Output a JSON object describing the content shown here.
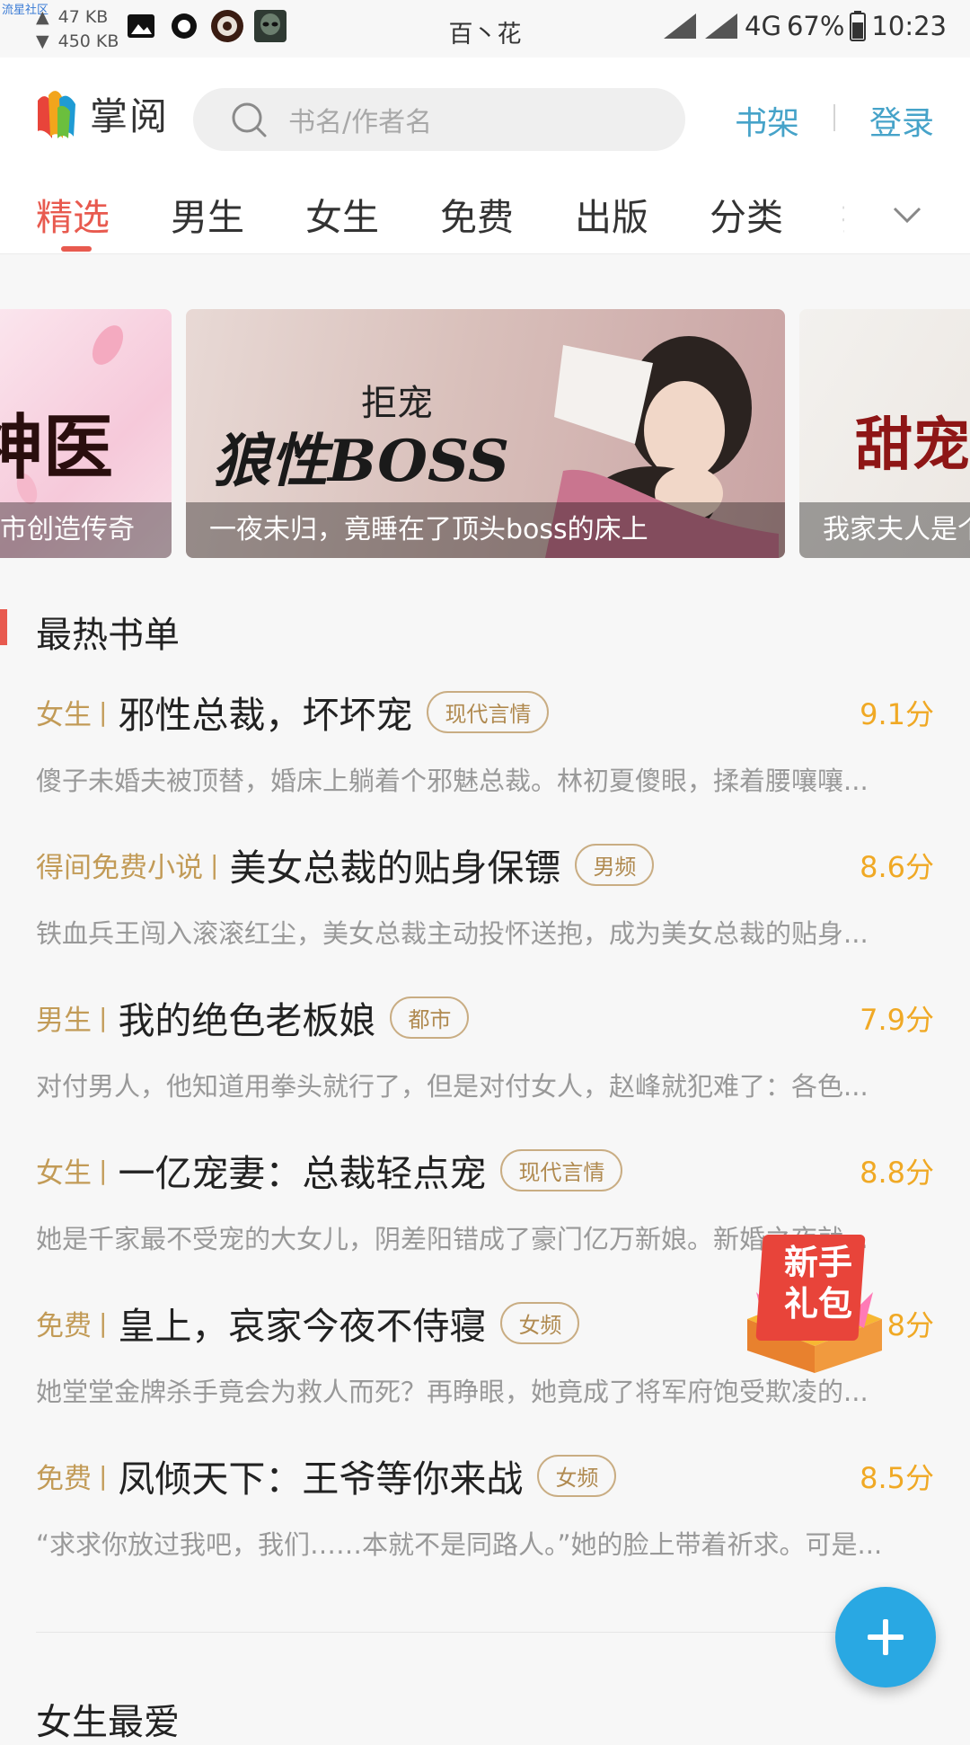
{
  "status_bar": {
    "watermark": "流星社区",
    "upload_rate": "47 KB",
    "download_rate": "450 KB",
    "carrier": "百丶花",
    "network": "4G",
    "battery": "67%",
    "time": "10:23"
  },
  "header": {
    "logo_text": "掌阅",
    "search_placeholder": "书名/作者名",
    "bookshelf_label": "书架",
    "login_label": "登录"
  },
  "tabs": [
    "精选",
    "男生",
    "女生",
    "免费",
    "出版",
    "分类",
    "排"
  ],
  "banners": [
    {
      "cover_title": "神医",
      "caption": "市创造传奇"
    },
    {
      "cover_subtitle": "拒宠",
      "cover_title": "狼性BOSS",
      "caption": "一夜未归，竟睡在了顶头boss的床上"
    },
    {
      "cover_title": "甜宠",
      "caption": "我家夫人是个"
    }
  ],
  "hot_list": {
    "title": "最热书单",
    "books": [
      {
        "category": "女生",
        "title": "邪性总裁，坏坏宠",
        "tag": "现代言情",
        "score": "9.1分",
        "desc": "傻子未婚夫被顶替，婚床上躺着个邪魅总裁。林初夏傻眼，揉着腰嚷嚷..."
      },
      {
        "category": "得间免费小说",
        "title": "美女总裁的贴身保镖",
        "tag": "男频",
        "score": "8.6分",
        "desc": "铁血兵王闯入滚滚红尘，美女总裁主动投怀送抱，成为美女总裁的贴身..."
      },
      {
        "category": "男生",
        "title": "我的绝色老板娘",
        "tag": "都市",
        "score": "7.9分",
        "desc": "对付男人，他知道用拳头就行了，但是对付女人，赵峰就犯难了：各色..."
      },
      {
        "category": "女生",
        "title": "一亿宠妻：总裁轻点宠",
        "tag": "现代言情",
        "score": "8.8分",
        "desc": "她是千家最不受宠的大女儿，阴差阳错成了豪门亿万新娘。新婚之夜就..."
      },
      {
        "category": "免费",
        "title": "皇上，哀家今夜不侍寝",
        "tag": "女频",
        "score": "8分",
        "desc": "她堂堂金牌杀手竟会为救人而死？再睁眼，她竟成了将军府饱受欺凌的..."
      },
      {
        "category": "免费",
        "title": "凤倾天下：王爷等你来战",
        "tag": "女频",
        "score": "8.5分",
        "desc": "“求求你放过我吧，我们……本就不是同路人。”她的脸上带着祈求。可是..."
      }
    ]
  },
  "next_section_title": "女生最爱",
  "gift_badge": {
    "line1": "新手",
    "line2": "礼包"
  },
  "fab": {
    "symbol": "+"
  }
}
